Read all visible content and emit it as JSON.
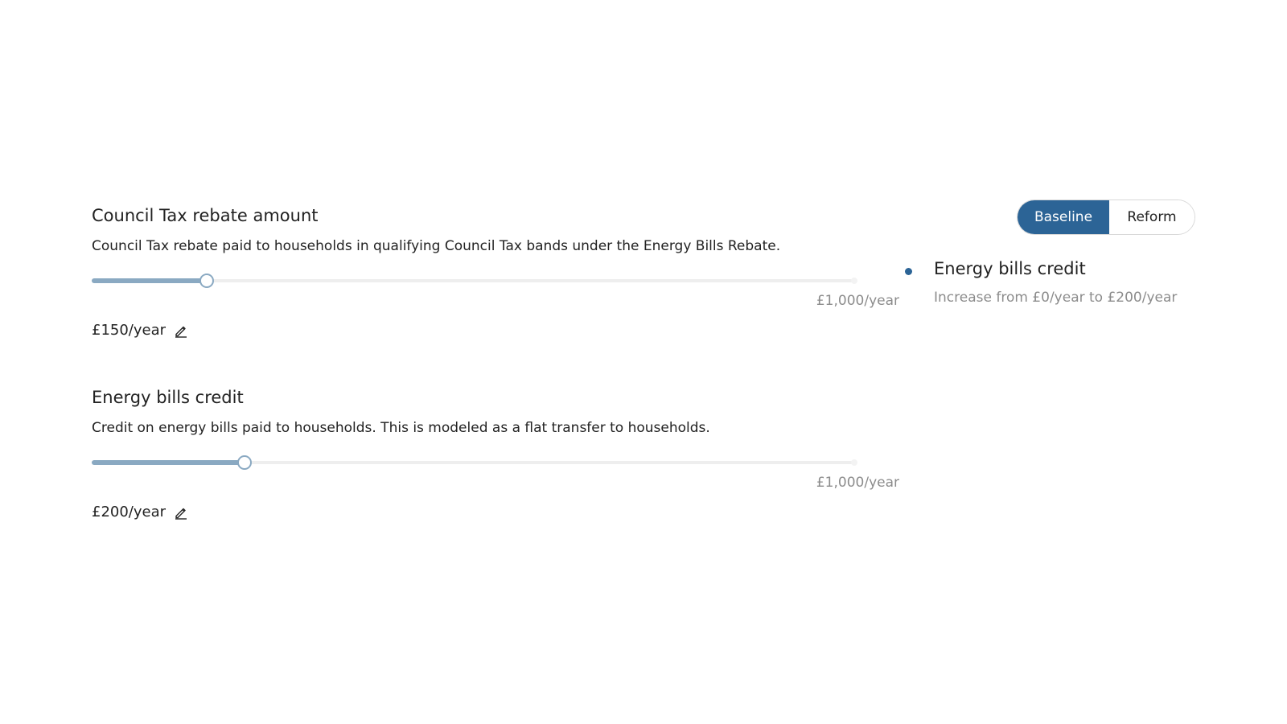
{
  "parameters": [
    {
      "title": "Council Tax rebate amount",
      "description": "Council Tax rebate paid to households in qualifying Council Tax bands under the Energy Bills Rebate.",
      "value_label": "£150/year",
      "max_label": "£1,000/year",
      "value": 150,
      "max": 1000
    },
    {
      "title": "Energy bills credit",
      "description": "Credit on energy bills paid to households. This is modeled as a flat transfer to households.",
      "value_label": "£200/year",
      "max_label": "£1,000/year",
      "value": 200,
      "max": 1000
    }
  ],
  "toggle": {
    "baseline_label": "Baseline",
    "reform_label": "Reform",
    "selected": "Baseline"
  },
  "changes": [
    {
      "title": "Energy bills credit",
      "description": "Increase from £0/year to £200/year"
    }
  ],
  "colors": {
    "accent": "#2c6496",
    "slider": "#8aa9c2",
    "muted_text": "#8c8c8c"
  },
  "icons": {
    "edit": "pencil-icon",
    "bullet": "dot"
  }
}
